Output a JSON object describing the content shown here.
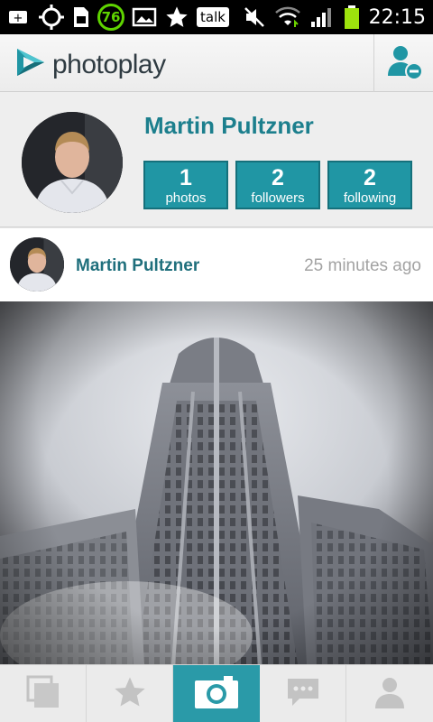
{
  "status_bar": {
    "notification_badge": "76",
    "talk_label": "talk",
    "time": "22:15"
  },
  "app": {
    "logo_part1": "photo",
    "logo_part2": "play",
    "accent_color": "#2096a4"
  },
  "profile": {
    "name": "Martin Pultzner",
    "stats": [
      {
        "value": "1",
        "label": "photos"
      },
      {
        "value": "2",
        "label": "followers"
      },
      {
        "value": "2",
        "label": "following"
      }
    ]
  },
  "post": {
    "author": "Martin Pultzner",
    "time": "25 minutes ago"
  },
  "bottom_nav": {
    "items": [
      {
        "icon": "gallery-icon",
        "active": false
      },
      {
        "icon": "star-icon",
        "active": false
      },
      {
        "icon": "camera-icon",
        "active": true
      },
      {
        "icon": "chat-icon",
        "active": false
      },
      {
        "icon": "profile-icon",
        "active": false
      }
    ]
  }
}
